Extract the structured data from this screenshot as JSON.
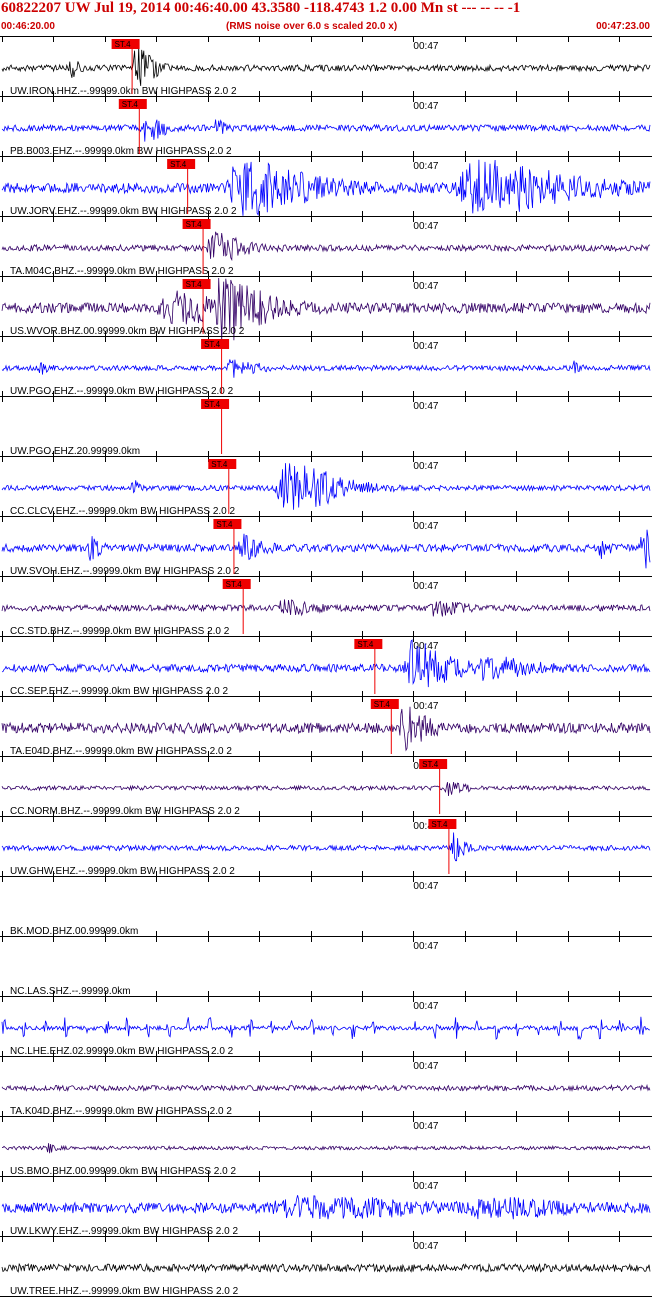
{
  "header": {
    "title": "60822207 UW Jul 19, 2014 00:46:40.00   43.3580 -118.4743  1.2 0.00 Mn st --- -- --  -1",
    "start_time": "00:46:20.00",
    "end_time": "00:47:23.00",
    "note": "(RMS noise over 6.0 s scaled 20.0 x)"
  },
  "colors": {
    "header_text": "#cc0000",
    "pick_box": "#ee0000",
    "trace_blue": "#0000ff",
    "trace_purple": "#330066",
    "trace_black": "#000000",
    "axis": "#000000"
  },
  "chart_data": {
    "type": "line",
    "title": "60822207 UW Jul 19, 2014 00:46:40.00   43.3580 -118.4743  1.2 0.00 Mn st --- -- --  -1",
    "x_range_seconds": [
      0,
      63
    ],
    "x_start_label": "00:46:20.00",
    "x_end_label": "00:47:23.00",
    "minute_tick_label": "00:47",
    "minute_tick_seconds": 40,
    "tick_interval_seconds": 5,
    "pick_label": "ST.4",
    "series": [
      {
        "name": "UW.IRON.HHZ.--.99999.0km BW  HIGHPASS  2.0  2",
        "color": "black",
        "pick_seconds": 12.6,
        "noise": 0.12,
        "bursts": [
          {
            "t": 12.6,
            "amp": 1.0,
            "dur": 2.2
          },
          {
            "t": 6.5,
            "amp": 0.35,
            "dur": 1.0
          }
        ]
      },
      {
        "name": "PB.B003.EHZ.--.99999.0km BW  HIGHPASS  2.0  2",
        "color": "blue",
        "pick_seconds": 13.3,
        "noise": 0.12,
        "bursts": [
          {
            "t": 13.3,
            "amp": 0.75,
            "dur": 2.2
          },
          {
            "t": 20.5,
            "amp": 0.3,
            "dur": 1.2
          }
        ]
      },
      {
        "name": "UW.JORV.EHZ.--.99999.0km BW  HIGHPASS  2.0  2",
        "color": "blue",
        "pick_seconds": 18.0,
        "noise": 0.2,
        "bursts": [
          {
            "t": 21.5,
            "amp": 1.0,
            "dur": 9.0
          },
          {
            "t": 44.0,
            "amp": 1.0,
            "dur": 12.0
          }
        ]
      },
      {
        "name": "TA.M04C.BHZ.--.99999.0km BW  HIGHPASS  2.0  2",
        "color": "purple",
        "pick_seconds": 19.5,
        "noise": 0.12,
        "bursts": [
          {
            "t": 19.8,
            "amp": 0.55,
            "dur": 4.0
          }
        ]
      },
      {
        "name": "US.WVOR.BHZ.00.99999.0km BW  HIGHPASS  2.0  2",
        "color": "purple",
        "pick_seconds": 19.5,
        "noise": 0.2,
        "bursts": [
          {
            "t": 15.0,
            "amp": 0.5,
            "dur": 10.0
          },
          {
            "t": 20.5,
            "amp": 1.0,
            "dur": 5.0
          }
        ]
      },
      {
        "name": "UW.PGO.EHZ.--.99999.0km BW  HIGHPASS  2.0  2",
        "color": "blue",
        "pick_seconds": 21.3,
        "noise": 0.1,
        "bursts": [
          {
            "t": 21.8,
            "amp": 0.4,
            "dur": 3.0
          },
          {
            "t": 3.5,
            "amp": 0.2,
            "dur": 1.0
          },
          {
            "t": 55.5,
            "amp": 0.25,
            "dur": 1.0
          }
        ]
      },
      {
        "name": "UW.PGO.EHZ.20.99999.0km",
        "color": "blue",
        "pick_seconds": 21.3,
        "noise": 0.0,
        "bursts": []
      },
      {
        "name": "CC.CLCV.EHZ.--.99999.0km BW  HIGHPASS  2.0  2",
        "color": "blue",
        "pick_seconds": 22.0,
        "noise": 0.1,
        "bursts": [
          {
            "t": 26.5,
            "amp": 1.0,
            "dur": 7.0
          },
          {
            "t": 12.5,
            "amp": 0.4,
            "dur": 0.8
          }
        ]
      },
      {
        "name": "UW.SVOH.EHZ.--.99999.0km BW  HIGHPASS  2.0  2",
        "color": "blue",
        "pick_seconds": 22.5,
        "noise": 0.15,
        "bursts": [
          {
            "t": 22.8,
            "amp": 0.45,
            "dur": 2.5
          },
          {
            "t": 8.3,
            "amp": 0.45,
            "dur": 1.2
          },
          {
            "t": 62.0,
            "amp": 0.95,
            "dur": 1.2
          },
          {
            "t": 58.0,
            "amp": 0.3,
            "dur": 1.0
          }
        ]
      },
      {
        "name": "CC.STD.BHZ.--.99999.0km BW  HIGHPASS  2.0  2",
        "color": "purple",
        "pick_seconds": 23.4,
        "noise": 0.12,
        "bursts": [
          {
            "t": 26.5,
            "amp": 0.25,
            "dur": 4.0
          },
          {
            "t": 41.5,
            "amp": 0.3,
            "dur": 3.0
          }
        ]
      },
      {
        "name": "CC.SEP.EHZ.--.99999.0km BW  HIGHPASS  2.0  2",
        "color": "blue",
        "pick_seconds": 36.2,
        "noise": 0.15,
        "bursts": [
          {
            "t": 39.0,
            "amp": 1.0,
            "dur": 5.0
          },
          {
            "t": 46.0,
            "amp": 0.4,
            "dur": 6.0
          }
        ]
      },
      {
        "name": "TA.E04D.BHZ.--.99999.0km BW  HIGHPASS  2.0  2",
        "color": "purple",
        "pick_seconds": 37.8,
        "noise": 0.2,
        "bursts": [
          {
            "t": 38.5,
            "amp": 0.8,
            "dur": 3.0
          }
        ]
      },
      {
        "name": "CC.NORM.BHZ.--.99999.0km BW  HIGHPASS  2.0  2",
        "color": "purple",
        "pick_seconds": 42.5,
        "noise": 0.08,
        "bursts": [
          {
            "t": 43.0,
            "amp": 0.25,
            "dur": 2.5
          }
        ]
      },
      {
        "name": "UW.GHW.EHZ.--.99999.0km BW  HIGHPASS  2.0  2",
        "color": "blue",
        "pick_seconds": 43.4,
        "noise": 0.1,
        "bursts": [
          {
            "t": 43.6,
            "amp": 0.6,
            "dur": 1.5
          }
        ]
      },
      {
        "name": "BK.MOD.BHZ.00.99999.0km",
        "color": "blue",
        "pick_seconds": null,
        "noise": 0.0,
        "bursts": []
      },
      {
        "name": "NC.LAS.SHZ.--.99999.0km",
        "color": "blue",
        "pick_seconds": null,
        "noise": 0.0,
        "bursts": []
      },
      {
        "name": "NC.LHE.EHZ.02.99999.0km BW  HIGHPASS  2.0  2",
        "color": "blue",
        "pick_seconds": null,
        "noise": 0.08,
        "periodic": true,
        "bursts": []
      },
      {
        "name": "TA.K04D.BHZ.--.99999.0km BW  HIGHPASS  2.0  2",
        "color": "purple",
        "pick_seconds": null,
        "noise": 0.1,
        "bursts": []
      },
      {
        "name": "US.BMO.BHZ.00.99999.0km BW  HIGHPASS  2.0  2",
        "color": "purple",
        "pick_seconds": null,
        "noise": 0.07,
        "bursts": [
          {
            "t": 4.3,
            "amp": 0.3,
            "dur": 0.8
          }
        ]
      },
      {
        "name": "UW.LKWY.EHZ.--.99999.0km BW  HIGHPASS  2.0  2",
        "color": "blue",
        "pick_seconds": null,
        "noise": 0.2,
        "bursts": [
          {
            "t": 26.0,
            "amp": 0.35,
            "dur": 16.0
          },
          {
            "t": 45.5,
            "amp": 0.35,
            "dur": 8.0
          }
        ]
      },
      {
        "name": "UW.TREE.HHZ.--.99999.0km BW  HIGHPASS  2.0  2",
        "color": "black",
        "pick_seconds": null,
        "noise": 0.15,
        "bursts": []
      }
    ]
  }
}
